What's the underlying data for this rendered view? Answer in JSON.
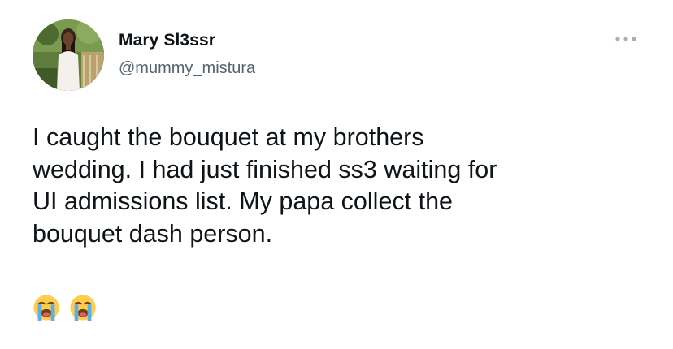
{
  "tweet": {
    "author": {
      "display_name": "Mary Sl3ssr",
      "handle": "@mummy_mistura",
      "avatar_icon": "profile-photo"
    },
    "more_icon": "more-horizontal-icon",
    "text_lines": [
      "I caught the bouquet at my brothers",
      "wedding. I had just finished ss3 waiting for",
      "UI admissions list. My papa collect the",
      "bouquet dash person."
    ],
    "emojis": [
      "loudly-crying-face-icon",
      "loudly-crying-face-icon"
    ]
  },
  "colors": {
    "text": "#0f1419",
    "secondary_text": "#536471",
    "more_icon": "#a6b0b8",
    "background": "#ffffff"
  }
}
